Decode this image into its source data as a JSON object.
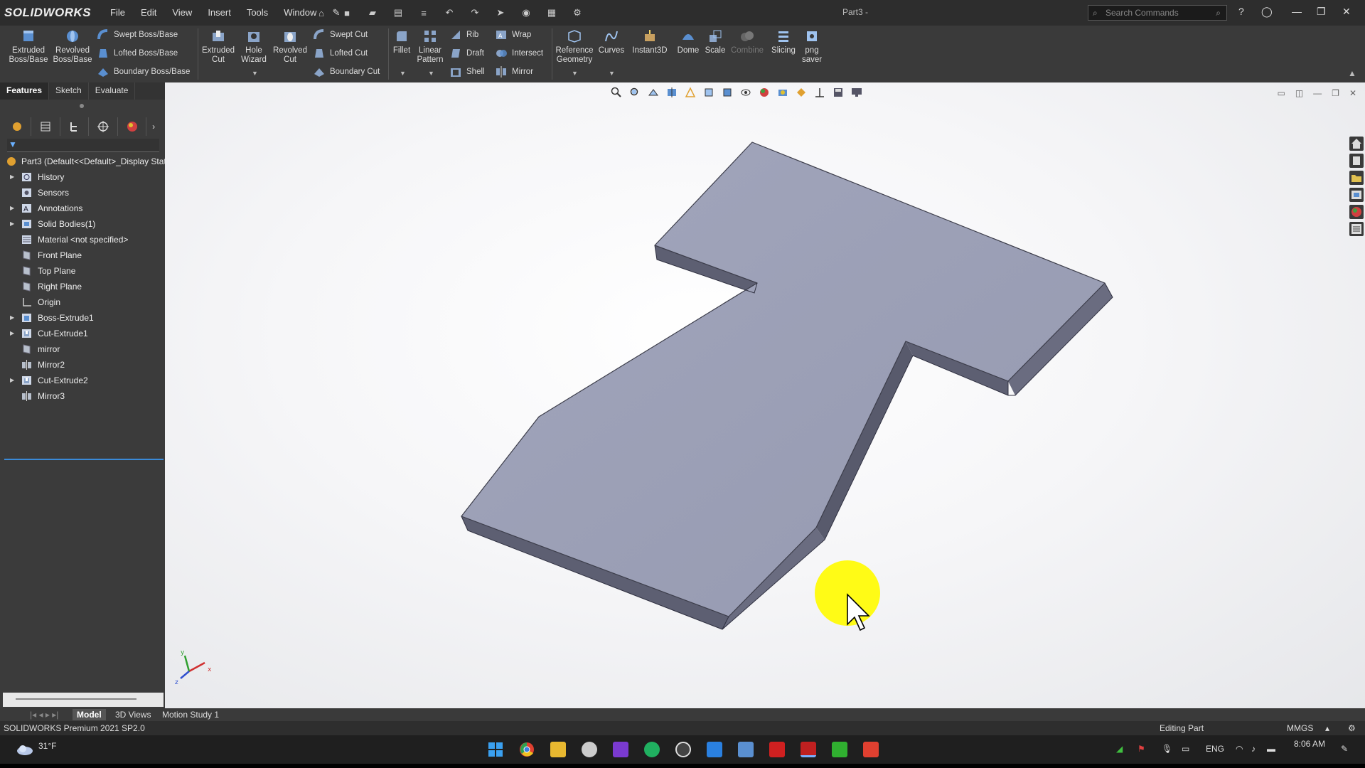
{
  "app": {
    "logo_text": "SOLIDWORKS",
    "document_title": "Part3 -",
    "search_placeholder": "Search Commands"
  },
  "menu": [
    "File",
    "Edit",
    "View",
    "Insert",
    "Tools",
    "Window"
  ],
  "ribbon": {
    "extruded_boss": "Extruded\nBoss/Base",
    "revolved_boss": "Revolved\nBoss/Base",
    "swept_boss": "Swept Boss/Base",
    "lofted_boss": "Lofted Boss/Base",
    "boundary_boss": "Boundary Boss/Base",
    "extruded_cut": "Extruded\nCut",
    "hole_wizard": "Hole\nWizard",
    "revolved_cut": "Revolved\nCut",
    "swept_cut": "Swept Cut",
    "lofted_cut": "Lofted Cut",
    "boundary_cut": "Boundary Cut",
    "fillet": "Fillet",
    "linear_pattern": "Linear\nPattern",
    "rib": "Rib",
    "draft": "Draft",
    "shell": "Shell",
    "wrap": "Wrap",
    "intersect": "Intersect",
    "mirror": "Mirror",
    "reference_geometry": "Reference\nGeometry",
    "curves": "Curves",
    "instant3d": "Instant3D",
    "dome": "Dome",
    "scale": "Scale",
    "combine": "Combine",
    "slicing": "Slicing",
    "png_saver": "png\nsaver"
  },
  "command_tabs": [
    "Features",
    "Sketch",
    "Evaluate"
  ],
  "feature_tree": {
    "root": "Part3  (Default<<Default>_Display State",
    "items": [
      {
        "label": "History",
        "icon": "history-icon",
        "expandable": true
      },
      {
        "label": "Sensors",
        "icon": "sensor-icon",
        "expandable": false
      },
      {
        "label": "Annotations",
        "icon": "annotations-icon",
        "expandable": true
      },
      {
        "label": "Solid Bodies(1)",
        "icon": "solid-bodies-icon",
        "expandable": true
      },
      {
        "label": "Material <not specified>",
        "icon": "material-icon",
        "expandable": false
      },
      {
        "label": "Front Plane",
        "icon": "plane-icon",
        "expandable": false
      },
      {
        "label": "Top Plane",
        "icon": "plane-icon",
        "expandable": false
      },
      {
        "label": "Right Plane",
        "icon": "plane-icon",
        "expandable": false
      },
      {
        "label": "Origin",
        "icon": "origin-icon",
        "expandable": false
      },
      {
        "label": "Boss-Extrude1",
        "icon": "boss-extrude-icon",
        "expandable": true
      },
      {
        "label": "Cut-Extrude1",
        "icon": "cut-extrude-icon",
        "expandable": true
      },
      {
        "label": "mirror",
        "icon": "plane-icon",
        "expandable": false
      },
      {
        "label": "Mirror2",
        "icon": "mirror-icon",
        "expandable": false
      },
      {
        "label": "Cut-Extrude2",
        "icon": "cut-extrude-icon",
        "expandable": true
      },
      {
        "label": "Mirror3",
        "icon": "mirror-icon",
        "expandable": false
      }
    ]
  },
  "bottom_tabs": [
    "Model",
    "3D Views",
    "Motion Study 1"
  ],
  "status": {
    "left": "SOLIDWORKS Premium 2021 SP2.0",
    "mode": "Editing Part",
    "units": "MMGS"
  },
  "taskbar": {
    "weather": "31°F",
    "language": "ENG",
    "time": "8:06 AM"
  },
  "colors": {
    "model_face": "#9da1b8",
    "model_side": "#5f6175",
    "cursor_highlight": "#fffb0a",
    "selection_line": "#3a8ad8"
  }
}
